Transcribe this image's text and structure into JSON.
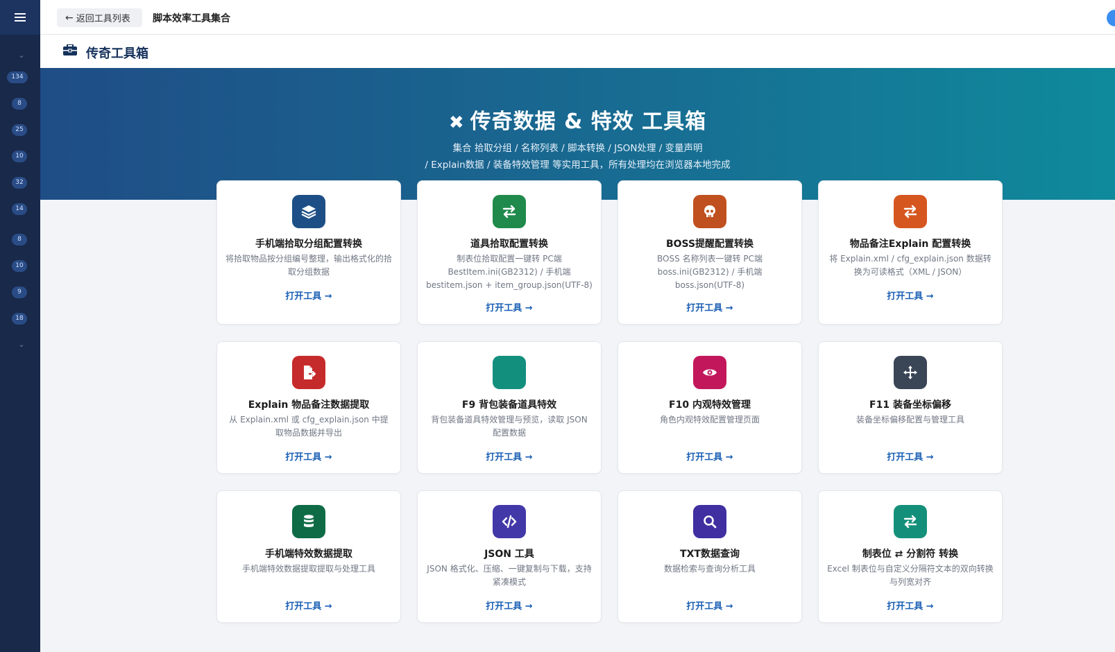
{
  "sidebar": {
    "badges": [
      "134",
      "8",
      "25",
      "10",
      "32",
      "14",
      "8",
      "10",
      "9",
      "18"
    ]
  },
  "topbar": {
    "back_label": "返回工具列表",
    "breadcrumb": "脚本效率工具集合"
  },
  "subheader": {
    "title": "传奇工具箱"
  },
  "hero": {
    "title": "传奇数据 & 特效 工具箱",
    "subtitle_line1": "集合 拾取分组 / 名称列表 / 脚本转换 / JSON处理 / 变量声明",
    "subtitle_line2": "/ Explain数据 / 装备特效管理 等实用工具，所有处理均在浏览器本地完成"
  },
  "open_label": "打开工具 →",
  "cards": [
    {
      "title": "手机端拾取分组配置转换",
      "desc": "将拾取物品按分组编号整理，输出格式化的拾取分组数据",
      "icon": "layers-icon",
      "color": "#1d4f86"
    },
    {
      "title": "道具拾取配置转换",
      "desc": "制表位拾取配置一键转 PC端 BestItem.ini(GB2312) / 手机端 bestitem.json + item_group.json(UTF-8)",
      "icon": "swap-icon",
      "color": "#1f8a4c"
    },
    {
      "title": "BOSS提醒配置转换",
      "desc": "BOSS 名称列表一键转 PC端 boss.ini(GB2312) / 手机端 boss.json(UTF-8)",
      "icon": "skull-icon",
      "color": "#c0501f"
    },
    {
      "title": "物品备注Explain 配置转换",
      "desc": "将 Explain.xml / cfg_explain.json 数据转换为可读格式（XML / JSON）",
      "icon": "swap-icon",
      "color": "#d6561f"
    },
    {
      "title": "Explain 物品备注数据提取",
      "desc": "从 Explain.xml 或 cfg_explain.json 中提取物品数据并导出",
      "icon": "file-export-icon",
      "color": "#c62b2b"
    },
    {
      "title": "F9 背包装备道具特效",
      "desc": "背包装备道具特效管理与预览，读取 JSON 配置数据",
      "icon": "blank-icon",
      "color": "#138f7e"
    },
    {
      "title": "F10 内观特效管理",
      "desc": "角色内观特效配置管理页面",
      "icon": "eye-icon",
      "color": "#c2185b"
    },
    {
      "title": "F11 装备坐标偏移",
      "desc": "装备坐标偏移配置与管理工具",
      "icon": "move-icon",
      "color": "#3a4556"
    },
    {
      "title": "手机端特效数据提取",
      "desc": "手机端特效数据提取提取与处理工具",
      "icon": "database-icon",
      "color": "#0e6b45"
    },
    {
      "title": "JSON 工具",
      "desc": "JSON 格式化、压缩、一键复制与下载，支持紧凑模式",
      "icon": "code-icon",
      "color": "#4338a8"
    },
    {
      "title": "TXT数据查询",
      "desc": "数据检索与查询分析工具",
      "icon": "search-icon",
      "color": "#3f2fa0"
    },
    {
      "title": "制表位 ⇄ 分割符 转换",
      "desc": "Excel 制表位与自定义分隔符文本的双向转换与列宽对齐",
      "icon": "swap-icon",
      "color": "#14907a"
    }
  ]
}
